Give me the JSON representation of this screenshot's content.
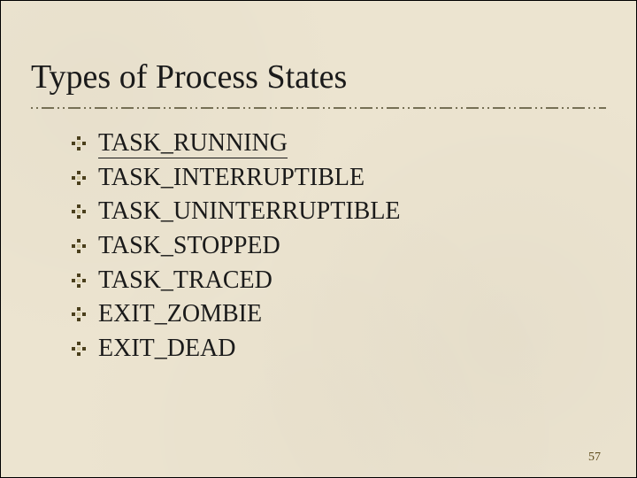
{
  "title": "Types of Process States",
  "items": [
    {
      "label": "TASK_RUNNING",
      "linked": true
    },
    {
      "label": "TASK_INTERRUPTIBLE",
      "linked": false
    },
    {
      "label": "TASK_UNINTERRUPTIBLE",
      "linked": false
    },
    {
      "label": "TASK_STOPPED",
      "linked": false
    },
    {
      "label": "TASK_TRACED",
      "linked": false
    },
    {
      "label": "EXIT_ZOMBIE",
      "linked": false
    },
    {
      "label": "EXIT_DEAD",
      "linked": false
    }
  ],
  "page_number": "57",
  "colors": {
    "background": "#ece4d0",
    "text": "#1a1a1a",
    "divider": "#767055",
    "bullet_dark": "#4a3f1c",
    "bullet_light": "#d7cda8",
    "pagenum": "#5d4a1b"
  }
}
